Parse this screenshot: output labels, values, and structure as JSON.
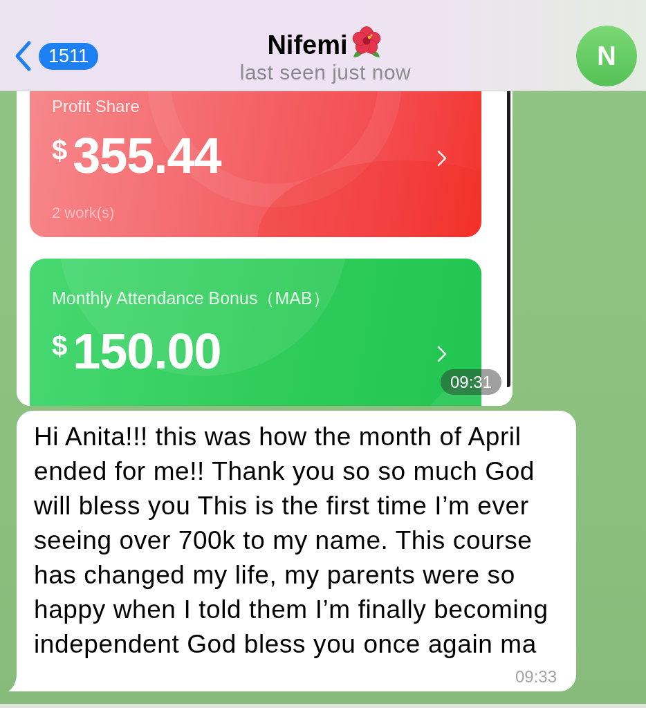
{
  "header": {
    "back_count": "1511",
    "title": "Nifemi",
    "status": "last seen just now",
    "avatar_initial": "N"
  },
  "messages": [
    {
      "kind": "image",
      "cards": [
        {
          "kind": "profit",
          "title": "Profit Share",
          "currency": "$",
          "amount": "355.44",
          "note": "2 work(s)"
        },
        {
          "kind": "bonus",
          "title": "Monthly Attendance Bonus（MAB）",
          "currency": "$",
          "amount": "150.00"
        }
      ],
      "time": "09:31"
    },
    {
      "kind": "text",
      "text": "Hi Anita!!! this was how the month of April ended for me!! Thank you so so much God will bless you This is the first time I’m ever seeing over 700k to my name. This course has changed my life, my parents were so happy when I told them I’m finally becoming independent God bless you once again ma",
      "time": "09:33"
    }
  ]
}
